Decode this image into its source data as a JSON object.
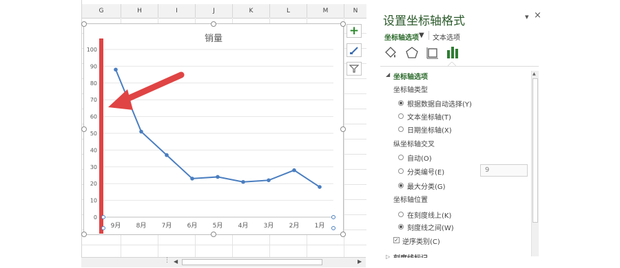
{
  "columns": [
    "G",
    "H",
    "I",
    "J",
    "K",
    "L",
    "M",
    "N"
  ],
  "chart": {
    "title": "销量",
    "y_ticks": [
      "100",
      "90",
      "80",
      "70",
      "60",
      "50",
      "40",
      "30",
      "20",
      "10",
      "0"
    ],
    "categories": [
      "9月",
      "8月",
      "7月",
      "6月",
      "5月",
      "4月",
      "3月",
      "2月",
      "1月"
    ],
    "accent_color": "#e04444",
    "line_color": "#4a7ec0"
  },
  "chart_data": {
    "type": "line",
    "title": "销量",
    "categories": [
      "9月",
      "8月",
      "7月",
      "6月",
      "5月",
      "4月",
      "3月",
      "2月",
      "1月"
    ],
    "series": [
      {
        "values": [
          88,
          51,
          37,
          23,
          24,
          21,
          22,
          28,
          18
        ]
      }
    ],
    "ylim": [
      0,
      100
    ],
    "y_ticks": [
      0,
      10,
      20,
      30,
      40,
      50,
      60,
      70,
      80,
      90,
      100
    ],
    "grid": true,
    "x_reversed": true
  },
  "toolbar_icons": [
    "plus-icon",
    "brush-icon",
    "filter-icon"
  ],
  "pane": {
    "title": "设置坐标轴格式",
    "tab_axis_options": "坐标轴选项",
    "tab_text_options": "文本选项",
    "section_header": "坐标轴选项",
    "axis_type_label": "坐标轴类型",
    "axis_type_options": [
      {
        "label": "根据数据自动选择(Y)",
        "selected": true
      },
      {
        "label": "文本坐标轴(T)",
        "selected": false
      },
      {
        "label": "日期坐标轴(X)",
        "selected": false
      }
    ],
    "cross_label": "纵坐标轴交叉",
    "cross_options": [
      {
        "label": "自动(O)",
        "selected": false
      },
      {
        "label": "分类编号(E)",
        "selected": false
      },
      {
        "label": "最大分类(G)",
        "selected": true
      }
    ],
    "category_number_value": "9",
    "position_label": "坐标轴位置",
    "position_options": [
      {
        "label": "在刻度线上(K)",
        "selected": false
      },
      {
        "label": "刻度线之间(W)",
        "selected": true
      }
    ],
    "reverse_label": "逆序类别(C)",
    "reverse_checked": true,
    "next_section": "刻度线标记"
  }
}
